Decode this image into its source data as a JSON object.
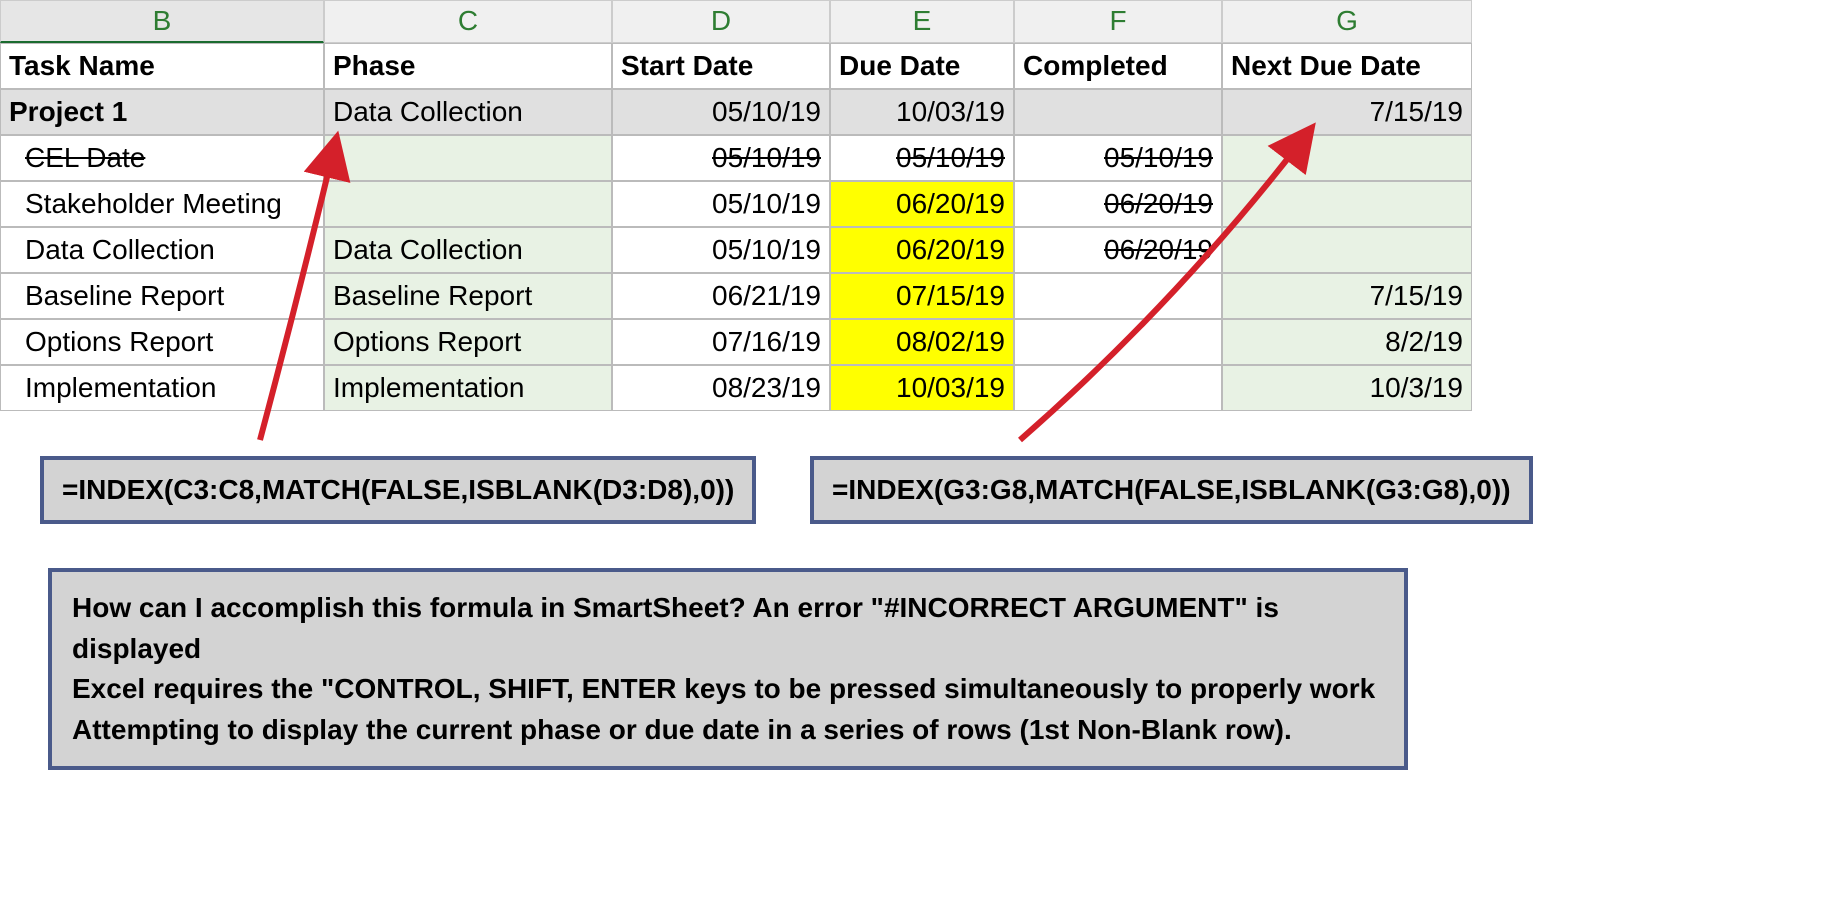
{
  "columns": [
    "B",
    "C",
    "D",
    "E",
    "F",
    "G"
  ],
  "headers": {
    "task_name": "Task Name",
    "phase": "Phase",
    "start_date": "Start  Date",
    "due_date": "Due Date",
    "completed": "Completed",
    "next_due": "Next Due Date"
  },
  "rows": [
    {
      "task": "Project 1",
      "phase": "Data Collection",
      "start": "05/10/19",
      "due": "10/03/19",
      "completed": "",
      "next": "7/15/19",
      "summary": true
    },
    {
      "task": "CEL Date",
      "phase": "",
      "start": "05/10/19",
      "due": "05/10/19",
      "completed": "05/10/19",
      "next": "",
      "strike_task": true,
      "strike_start": true,
      "strike_due": true,
      "strike_completed": true
    },
    {
      "task": "Stakeholder Meeting",
      "phase": "",
      "start": "05/10/19",
      "due": "06/20/19",
      "completed": "06/20/19",
      "next": "",
      "strike_completed": true,
      "due_yellow": true
    },
    {
      "task": "Data Collection",
      "phase": "Data Collection",
      "start": "05/10/19",
      "due": "06/20/19",
      "completed": "06/20/19",
      "next": "",
      "strike_completed": true,
      "due_yellow": true
    },
    {
      "task": "Baseline Report",
      "phase": "Baseline Report",
      "start": "06/21/19",
      "due": "07/15/19",
      "completed": "",
      "next": "7/15/19",
      "due_yellow": true
    },
    {
      "task": "Options Report",
      "phase": "Options Report",
      "start": "07/16/19",
      "due": "08/02/19",
      "completed": "",
      "next": "8/2/19",
      "due_yellow": true
    },
    {
      "task": "Implementation",
      "phase": "Implementation",
      "start": "08/23/19",
      "due": "10/03/19",
      "completed": "",
      "next": "10/3/19",
      "due_yellow": true
    }
  ],
  "formula1": "=INDEX(C3:C8,MATCH(FALSE,ISBLANK(D3:D8),0))",
  "formula2": "=INDEX(G3:G8,MATCH(FALSE,ISBLANK(G3:G8),0))",
  "question": {
    "line1": "How can I accomplish this formula in SmartSheet? An error \"#INCORRECT ARGUMENT\" is displayed",
    "line2": "Excel requires the \"CONTROL, SHIFT, ENTER keys to be pressed simultaneously to properly work",
    "line3": "Attempting to display the current phase or due date in a series of rows (1st Non-Blank row)."
  }
}
